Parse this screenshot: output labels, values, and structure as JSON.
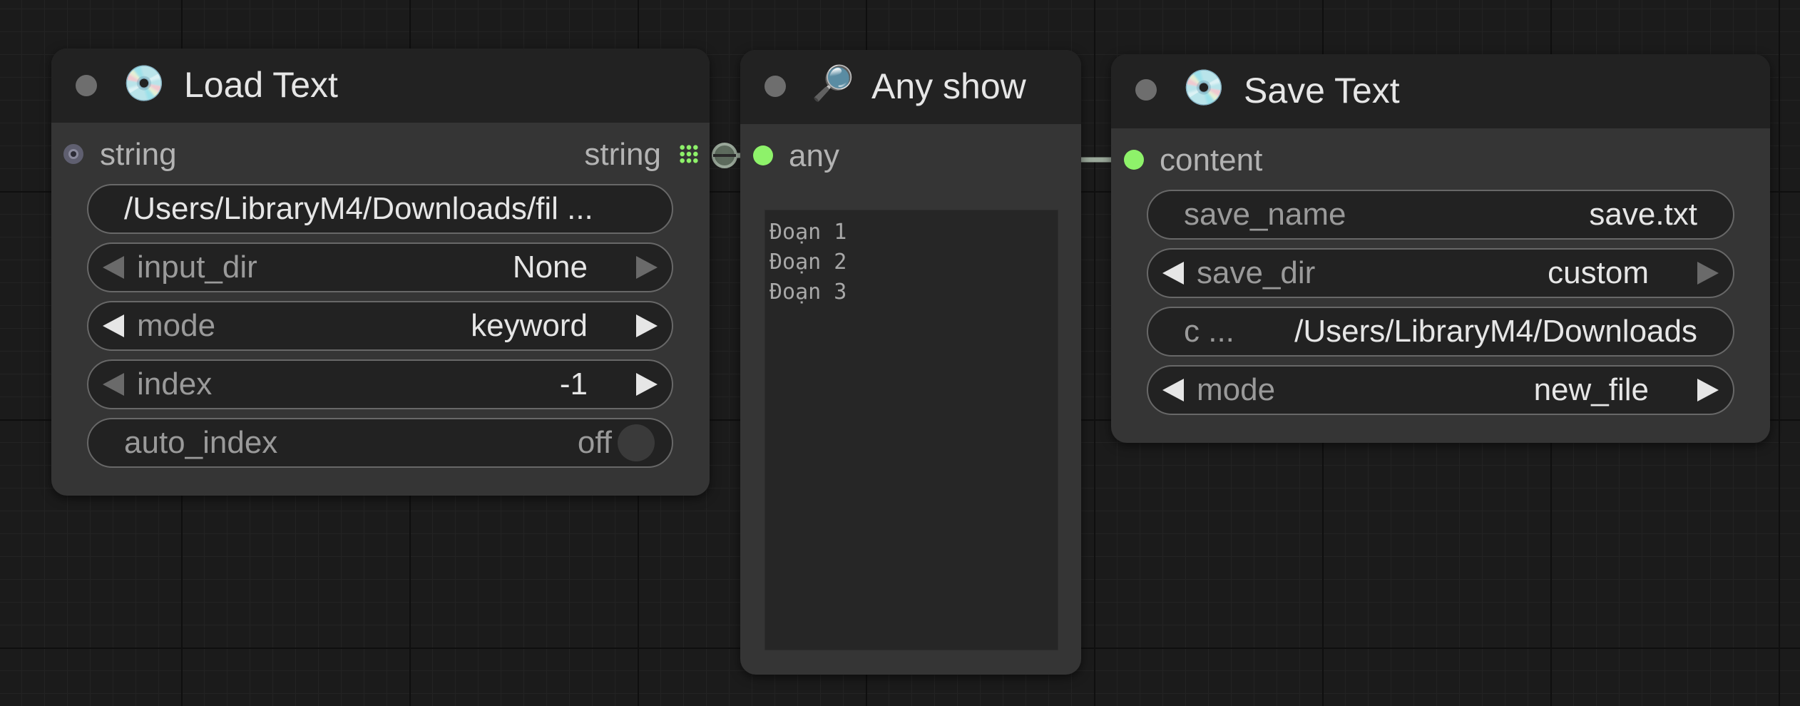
{
  "canvas": {
    "background": "#1b1b1b",
    "link_color": "#9aa89a",
    "slot_color_any": "#8ef26a"
  },
  "load_text": {
    "icon": "cd-icon",
    "icon_glyph": "💿",
    "title": "Load Text",
    "input_slot": "string",
    "output_slot": "string",
    "path_value": "/Users/LibraryM4/Downloads/fil  ...",
    "widgets": {
      "input_dir": {
        "label": "input_dir",
        "value": "None"
      },
      "mode": {
        "label": "mode",
        "value": "keyword"
      },
      "index": {
        "label": "index",
        "value": "-1"
      },
      "auto_index": {
        "label": "auto_index",
        "value": "off"
      }
    }
  },
  "any_show": {
    "icon": "magnifier-icon",
    "icon_glyph": "🔎",
    "title": "Any show",
    "input_slot": "any",
    "text_lines": [
      "Đoạn 1",
      "Đoạn 2",
      "Đoạn 3"
    ]
  },
  "save_text": {
    "icon": "cd-icon",
    "icon_glyph": "💿",
    "title": "Save Text",
    "input_slot": "content",
    "widgets": {
      "save_name": {
        "label": "save_name",
        "value": "save.txt"
      },
      "save_dir": {
        "label": "save_dir",
        "value": "custom"
      },
      "custom_dir": {
        "label": "c  ...",
        "value": "/Users/LibraryM4/Downloads"
      },
      "mode": {
        "label": "mode",
        "value": "new_file"
      }
    }
  }
}
